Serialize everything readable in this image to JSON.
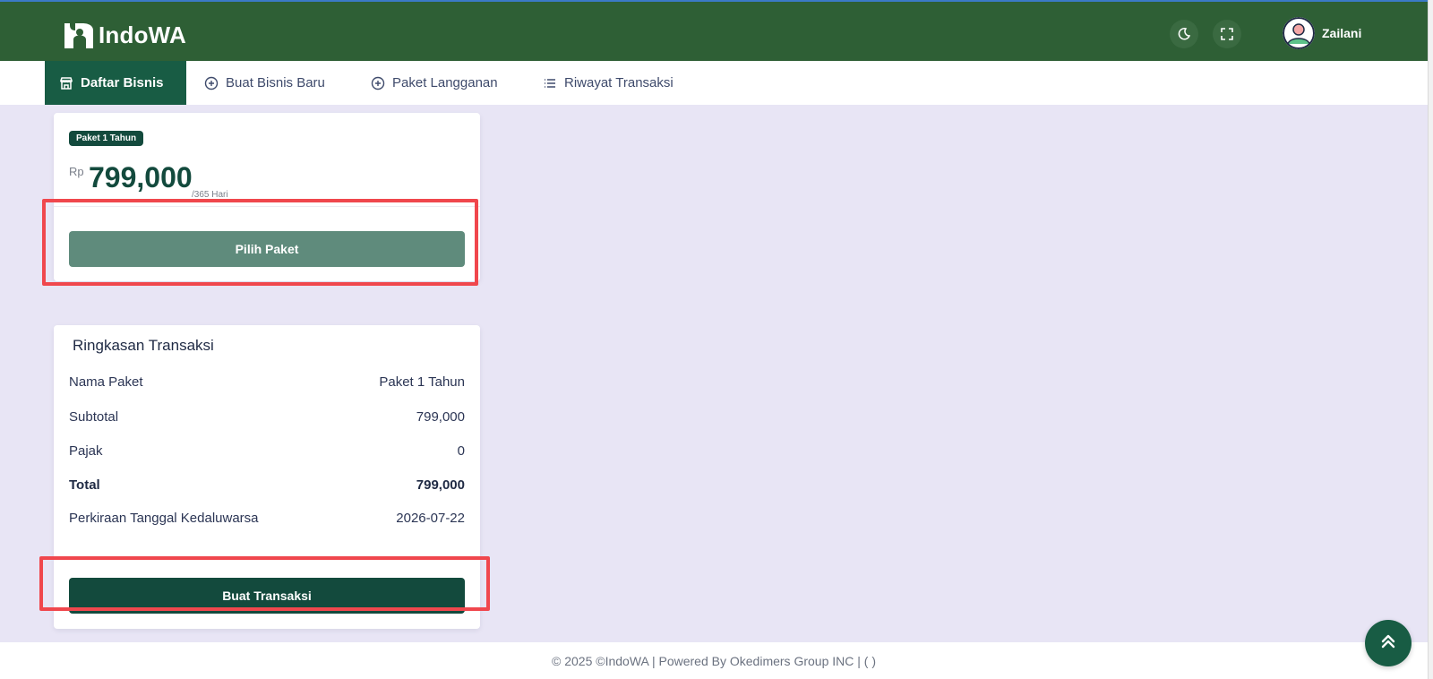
{
  "header": {
    "logo_text": "IndoWA",
    "logo_icon": "indowa-logo-icon",
    "theme_toggle_icon": "moon-icon",
    "fullscreen_icon": "fullscreen-icon",
    "user_name": "Zailani"
  },
  "nav": {
    "items": [
      {
        "label": "Daftar Bisnis",
        "icon": "store-icon",
        "active": true
      },
      {
        "label": "Buat Bisnis Baru",
        "icon": "plus-circle-icon",
        "active": false
      },
      {
        "label": "Paket Langganan",
        "icon": "plus-circle-icon",
        "active": false
      },
      {
        "label": "Riwayat Transaksi",
        "icon": "list-icon",
        "active": false
      }
    ]
  },
  "plan": {
    "badge": "Paket 1 Tahun",
    "currency": "Rp",
    "price": "799,000",
    "period": "/365 Hari",
    "select_label": "Pilih Paket"
  },
  "summary": {
    "title": "Ringkasan Transaksi",
    "rows": [
      {
        "label": "Nama Paket",
        "value": "Paket 1 Tahun"
      },
      {
        "label": "Subtotal",
        "value": "799,000"
      },
      {
        "label": "Pajak",
        "value": "0"
      },
      {
        "label": "Total",
        "value": "799,000"
      },
      {
        "label": "Perkiraan Tanggal Kedaluwarsa",
        "value": "2026-07-22"
      }
    ],
    "submit_label": "Buat Transaksi"
  },
  "footer": {
    "text": "© 2025 ©IndoWA | Powered By Okedimers Group INC | ( )"
  },
  "colors": {
    "header_bg": "#2e5f35",
    "primary": "#134a3d",
    "active_tab": "#185c44",
    "page_bg": "#e8e5f5",
    "highlight": "#f0474d"
  }
}
